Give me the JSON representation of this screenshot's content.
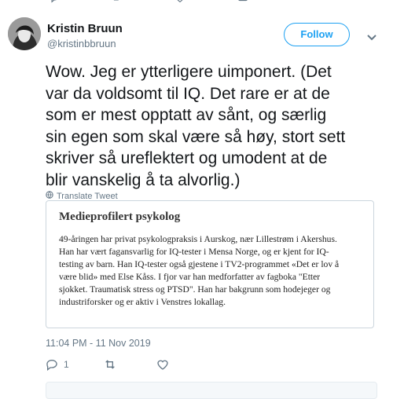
{
  "author": {
    "name": "Kristin Bruun",
    "handle": "@kristinbbruun"
  },
  "follow_button": {
    "label": "Follow"
  },
  "tweet": {
    "text": "Wow. Jeg er ytterligere uimponert. (Det\nvar da voldsomt til IQ. Det rare er at de\nsom er mest opptatt av sånt, og særlig\nsin egen som skal være så høy, stort sett\nskriver så ureflektert og umodent at de\nblir vanskelig å ta alvorlig.)",
    "translate_label": "Translate Tweet",
    "timestamp": "11:04 PM - 11 Nov 2019"
  },
  "quote": {
    "title": "Medieprofilert psykolog",
    "body": "49-åringen har privat psykologpraksis i Aurskog, nær Lillestrøm i Akershus.\nHan har vært fagansvarlig for IQ-tester i Mensa Norge, og er kjent for IQ-\ntesting av barn. Han IQ-tester også gjestene i TV2-programmet «Det er lov å\nvære blid» med Else Kåss. I fjor var han medforfatter av fagboka \"Etter\nsjokket. Traumatisk stress og PTSD\". Han har bakgrunn som hodejeger og\nindustriforsker og er aktiv i Venstres lokallag."
  },
  "actions": {
    "reply_count": "1",
    "retweet_count": "",
    "like_count": ""
  },
  "icons": [
    "reply-icon",
    "retweet-icon",
    "like-icon",
    "message-icon",
    "globe-icon",
    "chevron-down-icon"
  ],
  "colors": {
    "accent": "#1da1f2",
    "muted": "#657786",
    "border": "#ccd6dd"
  }
}
